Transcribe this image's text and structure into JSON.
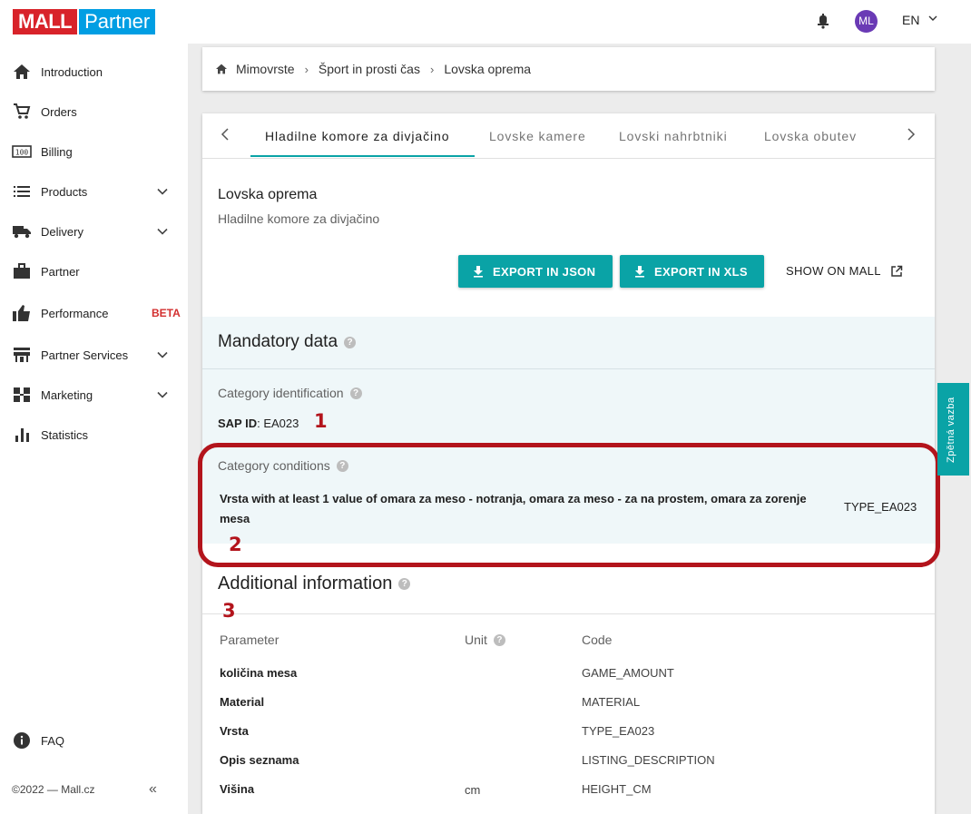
{
  "topbar": {
    "logo_mall": "MALL",
    "logo_partner": "Partner",
    "avatar_initials": "ML",
    "language": "EN"
  },
  "sidebar": {
    "items": [
      {
        "label": "Introduction",
        "icon": "home-icon",
        "expandable": false
      },
      {
        "label": "Orders",
        "icon": "cart-icon",
        "expandable": false
      },
      {
        "label": "Billing",
        "icon": "billing-icon",
        "expandable": false
      },
      {
        "label": "Products",
        "icon": "list-icon",
        "expandable": true
      },
      {
        "label": "Delivery",
        "icon": "truck-icon",
        "expandable": true
      },
      {
        "label": "Partner",
        "icon": "briefcase-icon",
        "expandable": false
      },
      {
        "label": "Performance",
        "icon": "thumbs-up-icon",
        "expandable": false,
        "badge": "BETA"
      },
      {
        "label": "Partner Services",
        "icon": "services-icon",
        "expandable": true
      },
      {
        "label": "Marketing",
        "icon": "marketing-icon",
        "expandable": true
      },
      {
        "label": "Statistics",
        "icon": "bar-chart-icon",
        "expandable": false
      }
    ],
    "faq_label": "FAQ",
    "copyright": "©2022 — Mall.cz",
    "collapse_glyph": "«"
  },
  "breadcrumb": {
    "items": [
      "Mimovrste",
      "Šport in prosti čas",
      "Lovska oprema"
    ],
    "separator": "›"
  },
  "tabs": {
    "items": [
      "Hladilne komore za divjačino",
      "Lovske kamere",
      "Lovski nahrbtniki",
      "Lovska obutev"
    ],
    "active_index": 0
  },
  "category": {
    "title": "Lovska oprema",
    "subtitle": "Hladilne komore za divjačino"
  },
  "actions": {
    "export_json": "EXPORT IN JSON",
    "export_xls": "EXPORT IN XLS",
    "show_on_mall": "SHOW ON MALL"
  },
  "mandatory": {
    "title": "Mandatory data",
    "identification_label": "Category identification",
    "sap_label": "SAP ID",
    "sap_value": ": EA023",
    "conditions_label": "Category conditions",
    "condition_text": "Vrsta with at least 1 value of omara za meso - notranja, omara za meso - za na prostem, omara za zorenje mesa",
    "condition_code": "TYPE_EA023"
  },
  "additional": {
    "title": "Additional information",
    "columns": [
      "Parameter",
      "Unit",
      "Code"
    ],
    "rows": [
      {
        "parameter": "količina mesa",
        "unit": "",
        "code": "GAME_AMOUNT"
      },
      {
        "parameter": "Material",
        "unit": "",
        "code": "MATERIAL"
      },
      {
        "parameter": "Vrsta",
        "unit": "",
        "code": "TYPE_EA023"
      },
      {
        "parameter": "Opis seznama",
        "unit": "",
        "code": "LISTING_DESCRIPTION"
      },
      {
        "parameter": "Višina",
        "unit": "cm",
        "code": "HEIGHT_CM"
      }
    ]
  },
  "annotations": {
    "marker_1": "1",
    "marker_2": "2",
    "marker_3": "3",
    "highlight_color": "#b3141c"
  },
  "feedback": {
    "label": "Zpětná vazba"
  },
  "colors": {
    "accent": "#0aa3a6",
    "mall_red": "#d8232a",
    "partner_blue": "#009ee3",
    "beta_red": "#d32f2f"
  }
}
